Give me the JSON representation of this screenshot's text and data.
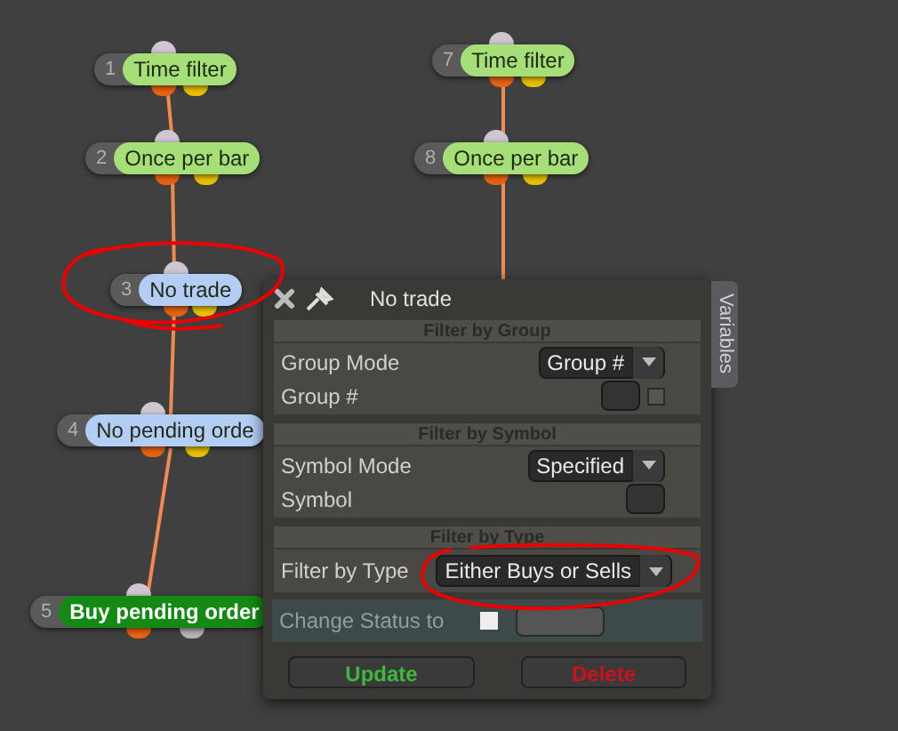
{
  "nodes": [
    {
      "number": "1",
      "label": "Time filter",
      "kind": "condition",
      "color": "#a6de78"
    },
    {
      "number": "2",
      "label": "Once per bar",
      "kind": "condition",
      "color": "#a6de78"
    },
    {
      "number": "3",
      "label": "No trade",
      "kind": "condition",
      "color": "#b4cdf5"
    },
    {
      "number": "4",
      "label": "No pending orde",
      "kind": "condition",
      "color": "#b4cdf5"
    },
    {
      "number": "5",
      "label": "Buy pending order",
      "kind": "action",
      "color": "#138a13"
    },
    {
      "number": "7",
      "label": "Time filter",
      "kind": "condition",
      "color": "#a6de78"
    },
    {
      "number": "8",
      "label": "Once per bar",
      "kind": "condition",
      "color": "#a6de78"
    }
  ],
  "dialog": {
    "title": "No trade",
    "side_tab": "Variables",
    "sections": [
      {
        "header": "Filter by Group",
        "rows": [
          {
            "label": "Group Mode",
            "kind": "select",
            "value": "Group #"
          },
          {
            "label": "Group #",
            "kind": "field_check",
            "checked": false
          }
        ]
      },
      {
        "header": "Filter by Symbol",
        "rows": [
          {
            "label": "Symbol Mode",
            "kind": "select",
            "value": "Specified"
          },
          {
            "label": "Symbol",
            "kind": "field"
          }
        ]
      },
      {
        "header": "Filter by Type",
        "rows": [
          {
            "label": "Filter by Type",
            "kind": "wide_select",
            "value": "Either Buys or Sells"
          }
        ]
      }
    ],
    "status_row": {
      "label": "Change Status to",
      "checked": false
    },
    "buttons": [
      {
        "label": "Update",
        "kind": "update"
      },
      {
        "label": "Delete",
        "kind": "delete"
      }
    ]
  }
}
